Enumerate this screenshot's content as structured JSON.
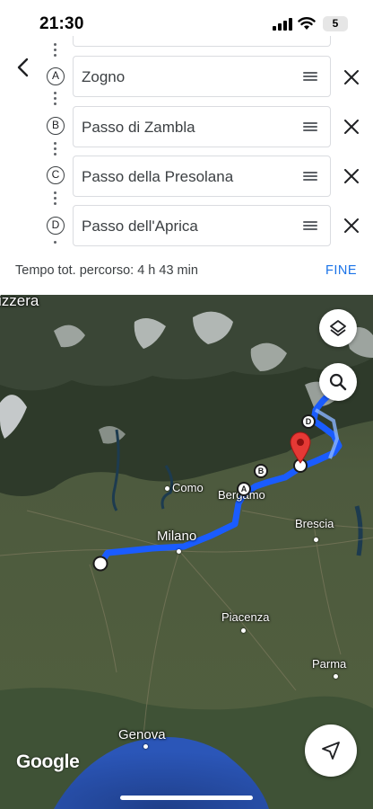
{
  "status_bar": {
    "time": "21:30",
    "battery": "5"
  },
  "route": {
    "stops": [
      {
        "marker": "A",
        "name": "Zogno"
      },
      {
        "marker": "B",
        "name": "Passo di Zambla"
      },
      {
        "marker": "C",
        "name": "Passo della Presolana"
      },
      {
        "marker": "D",
        "name": "Passo dell'Aprica"
      }
    ],
    "summary": "Tempo tot. percorso: 4 h 43 min",
    "done_label": "FINE"
  },
  "map": {
    "labels": {
      "country": "izzera",
      "como": "Como",
      "bergamo": "Bergamo",
      "brescia": "Brescia",
      "milano": "Milano",
      "piacenza": "Piacenza",
      "parma": "Parma",
      "genova": "Genova"
    },
    "pins": [
      "A",
      "B",
      "C",
      "D"
    ],
    "logo": "Google",
    "route_color": "#1a5cff",
    "destination_color": "#e53935"
  }
}
